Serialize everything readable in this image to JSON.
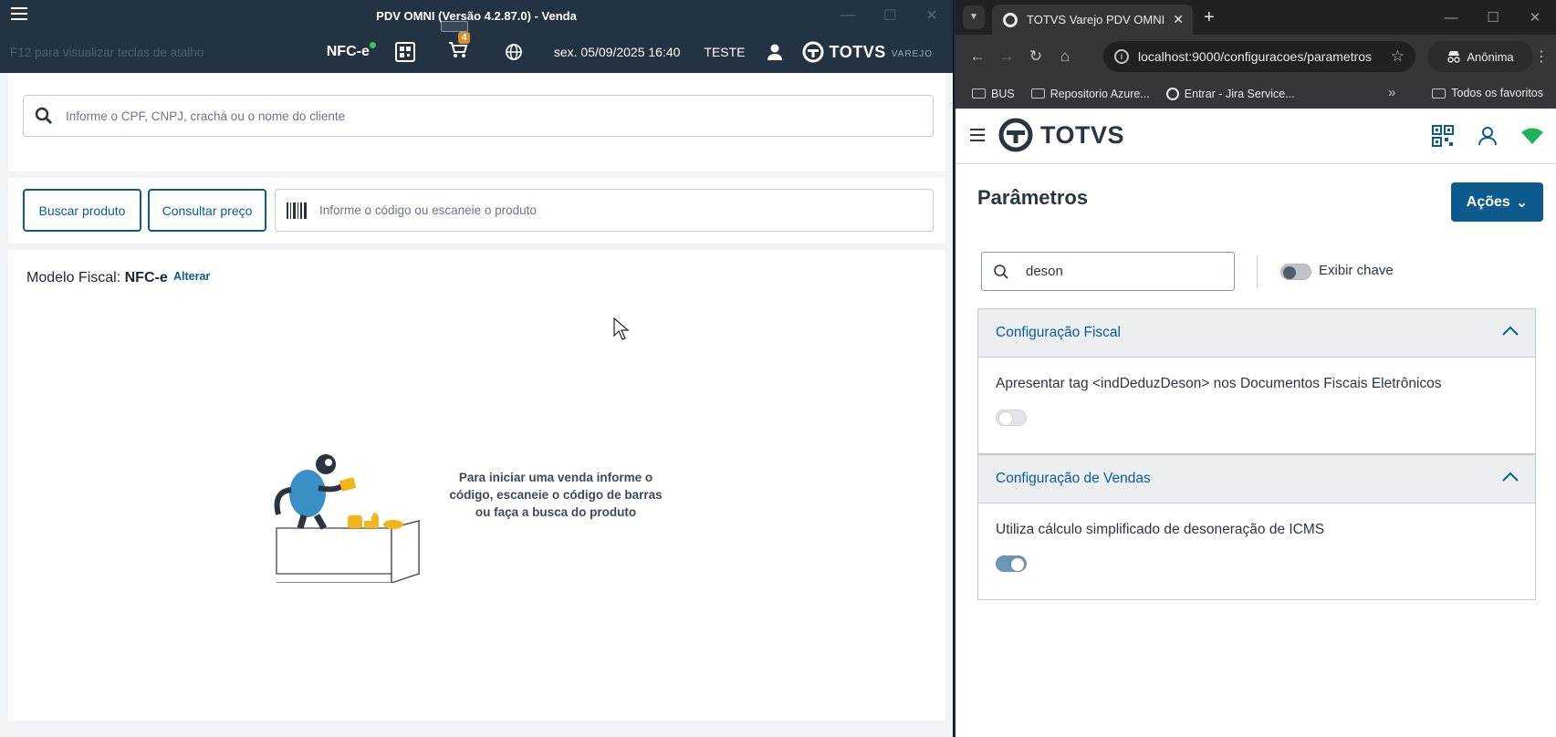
{
  "pdv": {
    "window_title": "PDV OMNI (Versão 4.2.87.0) - Venda",
    "hint": "F12 para visualizar teclas de atalho",
    "fiscal_doc": "NFC-e",
    "cart_count": "4",
    "datetime": "sex. 05/09/2025 16:40",
    "user": "TESTE",
    "brand": "TOTVS",
    "brand_sub": "VAREJO",
    "client_search_placeholder": "Informe o CPF, CNPJ, crachá ou o nome do cliente",
    "buscar_produto": "Buscar produto",
    "consultar_preco": "Consultar preço",
    "product_placeholder": "Informe o código ou escaneie o produto",
    "fiscal_label": "Modelo Fiscal:",
    "fiscal_value": "NFC-e",
    "alterar": "Alterar",
    "empty_message": "Para iniciar uma venda informe o código, escaneie o código de barras ou faça a busca do produto"
  },
  "browser": {
    "tab_title": "TOTVS Varejo PDV OMNI",
    "url": "localhost:9000/configuracoes/parametros",
    "profile": "Anônima",
    "bookmarks": [
      "BUS",
      "Repositorio Azure...",
      "Entrar - Jira Service..."
    ],
    "all_bookmarks": "Todos os favoritos"
  },
  "app": {
    "brand": "TOTVS",
    "page_title": "Parâmetros",
    "actions_button": "Ações",
    "search_value": "deson",
    "show_key_label": "Exibir chave",
    "show_key_on": false,
    "sections": [
      {
        "title": "Configuração Fiscal",
        "param_label": "Apresentar tag <indDeduzDeson> nos Documentos Fiscais Eletrônicos",
        "enabled": false
      },
      {
        "title": "Configuração de Vendas",
        "param_label": "Utiliza cálculo simplificado de desoneração de ICMS",
        "enabled": true
      }
    ],
    "accent_color": "#0c5b8c"
  }
}
